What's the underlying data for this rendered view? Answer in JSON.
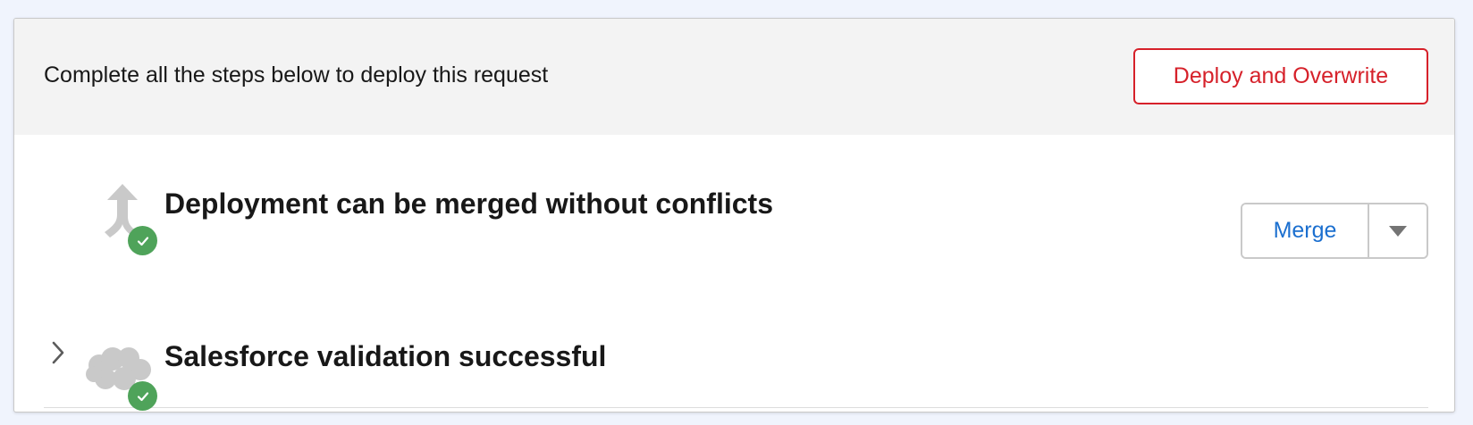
{
  "header": {
    "instruction": "Complete all the steps below to deploy this request",
    "deploy_button_label": "Deploy and Overwrite"
  },
  "steps": [
    {
      "icon": "merge-arrow-icon",
      "status": "success",
      "title": "Deployment can be merged without conflicts",
      "action_label": "Merge"
    },
    {
      "icon": "salesforce-cloud-icon",
      "status": "success",
      "title": "Salesforce validation successful",
      "expandable": true
    }
  ],
  "colors": {
    "page_background": "#f0f4fd",
    "header_background": "#f3f3f3",
    "destructive": "#d6212a",
    "brand_link": "#1b6fcf",
    "success": "#4fa35a",
    "icon_gray": "#c9c9c9"
  }
}
